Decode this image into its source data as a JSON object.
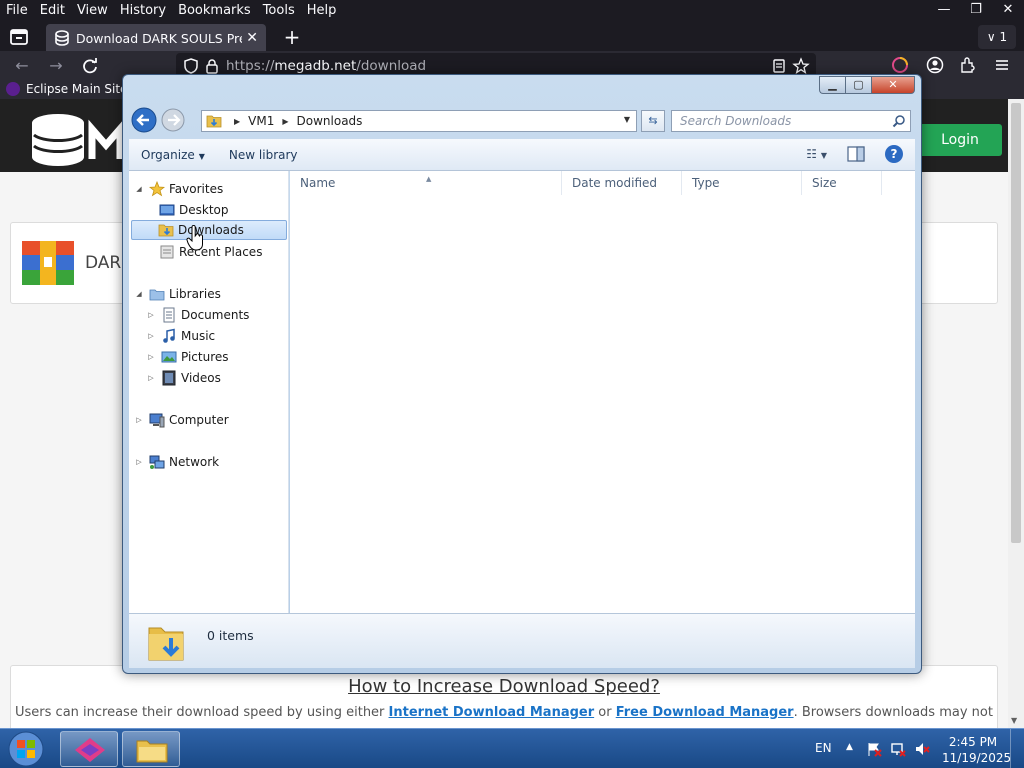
{
  "browser": {
    "menu": [
      "File",
      "Edit",
      "View",
      "History",
      "Bookmarks",
      "Tools",
      "Help"
    ],
    "tab_title": "Download DARK SOULS Prepare",
    "tab_count": "1",
    "url_scheme": "https://",
    "url_host": "megadb.net",
    "url_path": "/download",
    "bookmark": "Eclipse Main Site"
  },
  "page": {
    "login": "Login",
    "file_name_partial": "DAR",
    "info_title": "How to Increase Download Speed?",
    "info_text_before": "Users can increase their download speed by using either ",
    "link_idm": "Internet Download Manager",
    "info_text_or": " or ",
    "link_fdm": "Free Download Manager",
    "info_text_after": ". Browsers downloads may not"
  },
  "explorer": {
    "breadcrumb": [
      "VM1",
      "Downloads"
    ],
    "search_placeholder": "Search Downloads",
    "toolbar": {
      "organize": "Organize",
      "new_library": "New library"
    },
    "nav": {
      "favorites": "Favorites",
      "desktop": "Desktop",
      "downloads": "Downloads",
      "recent": "Recent Places",
      "libraries": "Libraries",
      "documents": "Documents",
      "music": "Music",
      "pictures": "Pictures",
      "videos": "Videos",
      "computer": "Computer",
      "network": "Network"
    },
    "columns": [
      "Name",
      "Date modified",
      "Type",
      "Size"
    ],
    "item_count": "0 items"
  },
  "taskbar": {
    "lang": "EN",
    "time": "2:45 PM",
    "date": "11/19/2025"
  },
  "colors": {
    "firefox_dark": "#1c1b22",
    "taskbar_blue": "#194986",
    "selection": "#c1dbf8",
    "login_green": "#23a455"
  }
}
